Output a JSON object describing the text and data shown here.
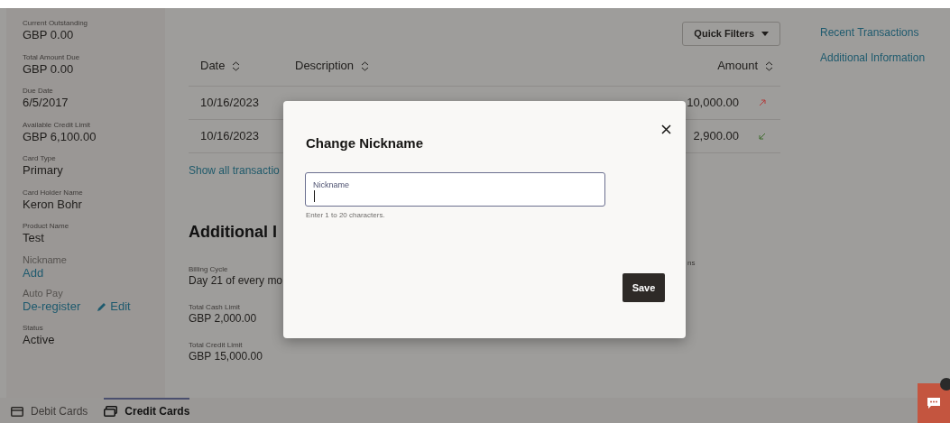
{
  "sidebar": {
    "fields": [
      {
        "label": "Current Outstanding",
        "value": "GBP 0.00",
        "kind": "text"
      },
      {
        "label": "Total Amount Due",
        "value": "GBP 0.00",
        "kind": "text"
      },
      {
        "label": "Due Date",
        "value": "6/5/2017",
        "kind": "text"
      },
      {
        "label": "Available Credit Limit",
        "value": "GBP 6,100.00",
        "kind": "text"
      },
      {
        "label": "Card Type",
        "value": "Primary",
        "kind": "text"
      },
      {
        "label": "Card Holder Name",
        "value": "Keron Bohr",
        "kind": "text"
      },
      {
        "label": "Product Name",
        "value": "Test",
        "kind": "text"
      },
      {
        "label": "Nickname",
        "value": "Add",
        "kind": "link"
      },
      {
        "label": "Auto Pay",
        "value": "De-register",
        "kind": "link",
        "action": "Edit"
      },
      {
        "label": "Status",
        "value": "Active",
        "kind": "text"
      }
    ]
  },
  "quick_filters": {
    "label": "Quick Filters"
  },
  "table": {
    "columns": [
      {
        "label": "Date"
      },
      {
        "label": "Description"
      },
      {
        "label": "Amount"
      }
    ],
    "rows": [
      {
        "date": "10/16/2023",
        "amount": "10,000.00",
        "kind": "outgoing"
      },
      {
        "date": "10/16/2023",
        "amount": "2,900.00",
        "kind": "incoming"
      }
    ]
  },
  "show_all_link": "Show all transactio",
  "section_title": "Additional I",
  "details": [
    {
      "label": "Billing Cycle",
      "value": "Day 21 of every mo"
    },
    {
      "label": "Total Cash Limit",
      "value": "GBP 2,000.00"
    },
    {
      "label": "Total Credit Limit",
      "value": "GBP 15,000.00"
    }
  ],
  "fragment": "ns",
  "nav": [
    {
      "label": "Recent Transactions"
    },
    {
      "label": "Additional Information"
    }
  ],
  "tabs": [
    {
      "label": "Debit Cards",
      "selected": false
    },
    {
      "label": "Credit Cards",
      "selected": true
    }
  ],
  "modal": {
    "title": "Change Nickname",
    "field_label": "Nickname",
    "hint": "Enter 1 to 20 characters.",
    "save": "Save"
  }
}
